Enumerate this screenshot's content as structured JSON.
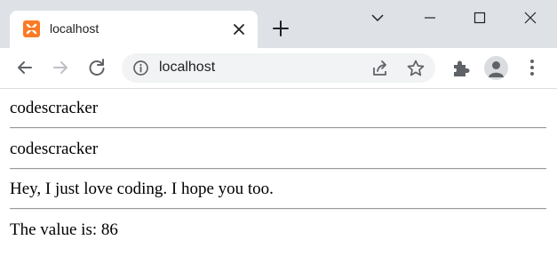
{
  "browser": {
    "tab_title": "localhost",
    "url": "localhost"
  },
  "icons": {
    "favicon": "xampp-favicon-icon",
    "tab_close": "close-icon",
    "new_tab": "plus-icon",
    "minimize": "minimize-icon",
    "maximize": "maximize-icon",
    "close_window": "close-icon",
    "tab_search": "chevron-down-icon",
    "back": "back-arrow-icon",
    "forward": "forward-arrow-icon",
    "reload": "reload-icon",
    "site_info": "info-icon",
    "share": "share-icon",
    "bookmark": "star-icon",
    "extensions": "puzzle-icon",
    "profile": "profile-icon",
    "menu": "kebab-menu-icon"
  },
  "colors": {
    "titlebar": "#dee1e6",
    "favicon": "#fb7a24"
  },
  "page": {
    "line1": "codescracker",
    "line2": "codescracker",
    "line3": "Hey, I just love coding. I hope you too.",
    "line4": "The value is: 86"
  }
}
